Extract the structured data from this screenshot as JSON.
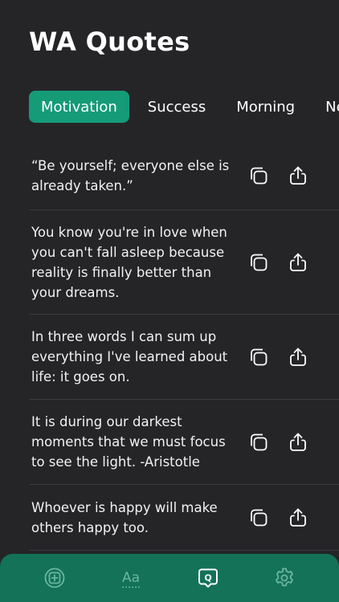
{
  "app": {
    "title": "WA Quotes"
  },
  "tabs": [
    {
      "label": "Motivation",
      "active": true
    },
    {
      "label": "Success",
      "active": false
    },
    {
      "label": "Morning",
      "active": false
    },
    {
      "label": "Ne",
      "active": false
    }
  ],
  "quotes": [
    {
      "text": "“Be yourself; everyone else is already taken.”"
    },
    {
      "text": "You know you're in love when you can't fall asleep because reality is finally better than your dreams."
    },
    {
      "text": "In three words I can sum up everything I've learned about life: it goes on."
    },
    {
      "text": "It is during our darkest moments that we must focus to see the light. -Aristotle"
    },
    {
      "text": "Whoever is happy will make others happy too."
    }
  ],
  "actions": {
    "copy_icon": "copy-icon",
    "share_icon": "share-icon"
  },
  "nav": [
    {
      "icon": "add-square-icon"
    },
    {
      "icon": "font-icon",
      "label": "Aa"
    },
    {
      "icon": "quote-bubble-icon",
      "label": "Q"
    },
    {
      "icon": "gear-icon"
    }
  ],
  "colors": {
    "background": "#252528",
    "accent": "#159b78",
    "nav_background": "#137258",
    "nav_inactive": "#6bb59f"
  }
}
